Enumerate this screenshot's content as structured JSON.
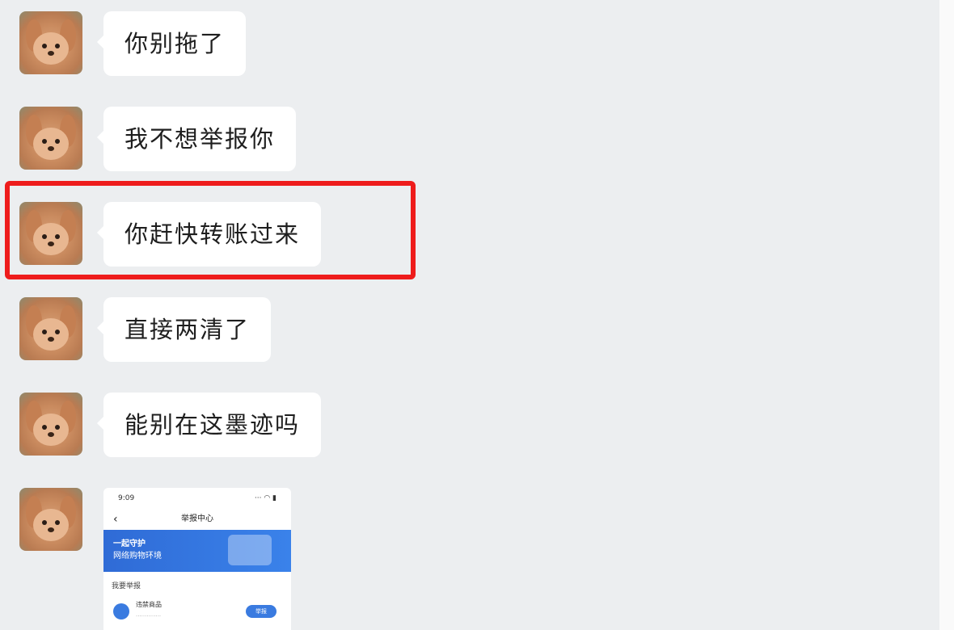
{
  "messages": [
    {
      "text": "你别拖了"
    },
    {
      "text": "我不想举报你"
    },
    {
      "text": "你赶快转账过来"
    },
    {
      "text": "直接两清了"
    },
    {
      "text": "能别在这墨迹吗"
    }
  ],
  "image_message": {
    "status_time": "9:09",
    "status_icons": "··· ◠ ▮",
    "nav_title": "举报中心",
    "back_icon": "‹",
    "banner_line1": "一起守护",
    "banner_line2": "网络购物环境",
    "section_title": "我要举报",
    "row_title": "违禁商品",
    "row_subtitle": "..............",
    "row_button": "举报"
  },
  "colors": {
    "bubble": "#ffffff",
    "background": "#eceef0",
    "highlight": "#ee1c1c",
    "banner": "#2f6bd6"
  }
}
